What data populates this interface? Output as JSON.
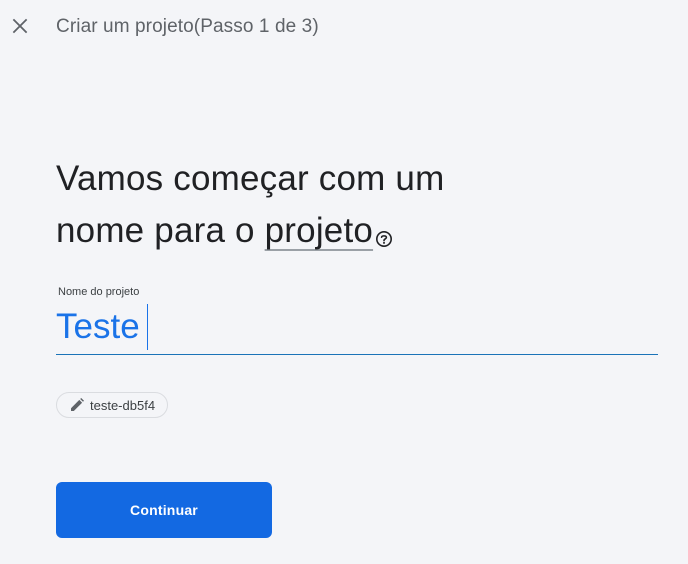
{
  "header": {
    "step_title": "Criar um projeto(Passo 1 de 3)",
    "close_icon": "close-icon"
  },
  "main": {
    "heading_line1": "Vamos começar com um",
    "heading_line2_prefix": "nome para o ",
    "heading_term": "projeto",
    "help_icon": "help-circle-icon"
  },
  "form": {
    "project_name_label": "Nome do projeto",
    "project_name_value": "Teste",
    "project_id_chip": "teste-db5f4",
    "edit_icon": "pencil-icon"
  },
  "actions": {
    "continue_label": "Continuar"
  },
  "colors": {
    "background": "#f4f5f8",
    "primary": "#1369e2",
    "input_text": "#1a73e8",
    "heading_text": "#202124",
    "secondary_text": "#5f6368"
  }
}
